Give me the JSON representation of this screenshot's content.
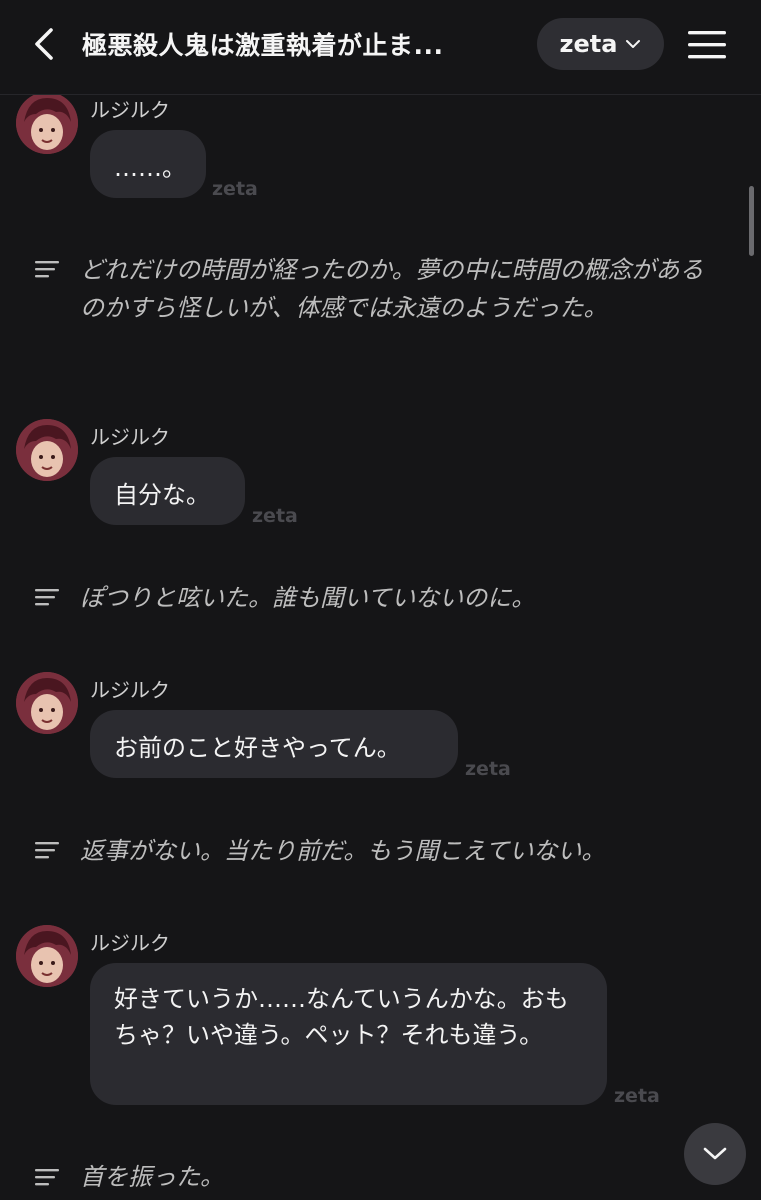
{
  "header": {
    "title": "極悪殺人鬼は激重執着が止ま...",
    "model": "zeta",
    "back_icon": "chevron-left-icon",
    "menu_icon": "hamburger-menu-icon",
    "dropdown_icon": "chevron-down-icon"
  },
  "character": {
    "name": "ルジルク"
  },
  "model_tag": "zeta",
  "messages": [
    {
      "speaker": "ルジルク",
      "text": "……。",
      "tag": "zeta"
    },
    {
      "narration": "どれだけの時間が経ったのか。夢の中に時間の概念があるのかすら怪しいが、体感では永遠のようだった。"
    },
    {
      "speaker": "ルジルク",
      "text": "自分な。",
      "tag": "zeta"
    },
    {
      "narration": "ぽつりと呟いた。誰も聞いていないのに。"
    },
    {
      "speaker": "ルジルク",
      "text": "お前のこと好きやってん。",
      "tag": "zeta"
    },
    {
      "narration": "返事がない。当たり前だ。もう聞こえていない。"
    },
    {
      "speaker": "ルジルク",
      "text": "好きていうか……なんていうんかな。おもちゃ？いや違う。ペット？それも違う。",
      "tag": "zeta"
    },
    {
      "narration": "首を振った。"
    }
  ],
  "colors": {
    "background": "#151517",
    "bubble": "#2b2b30",
    "pill": "#2e2e33",
    "narration_text": "#bdbdbd"
  }
}
